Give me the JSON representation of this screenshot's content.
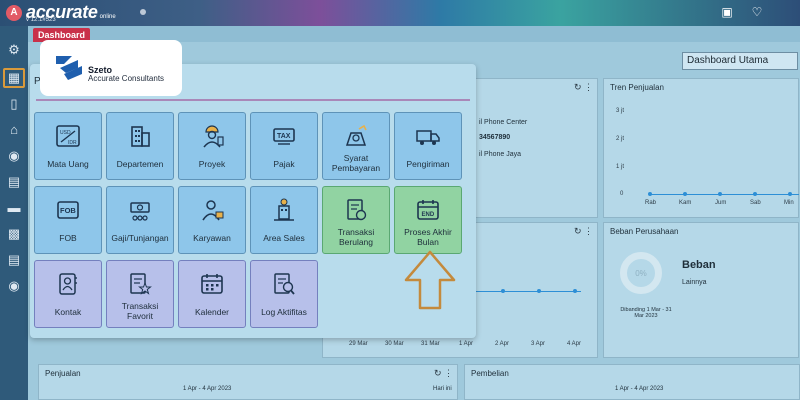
{
  "header": {
    "brand": "accurate",
    "brand_sub": "online",
    "version": "v 12.1#523",
    "icons": [
      "user-icon",
      "bell-icon"
    ]
  },
  "sidebar": {
    "icons": [
      "gear-icon",
      "building-icon",
      "phone-icon",
      "bank-icon",
      "bag-icon",
      "cart-icon",
      "truck-icon",
      "factory-icon",
      "receipt-icon",
      "report-icon"
    ],
    "active_index": 1
  },
  "tabs": [
    "Dashboard"
  ],
  "dashboard_select": "Dashboard Utama",
  "logo": {
    "line1": "Szeto",
    "line2": "Accurate Consultants"
  },
  "menu": {
    "header_letter": "P",
    "items": [
      {
        "label": "Mata Uang",
        "icon": "currency-icon",
        "color": "blue"
      },
      {
        "label": "Departemen",
        "icon": "building-icon",
        "color": "blue"
      },
      {
        "label": "Proyek",
        "icon": "engineer-icon",
        "color": "blue"
      },
      {
        "label": "Pajak",
        "icon": "tax-icon",
        "color": "blue"
      },
      {
        "label": "Syarat Pembayaran",
        "icon": "payment-terms-icon",
        "color": "blue"
      },
      {
        "label": "Pengiriman",
        "icon": "delivery-truck-icon",
        "color": "blue"
      },
      {
        "label": "FOB",
        "icon": "fob-icon",
        "color": "blue"
      },
      {
        "label": "Gaji/Tunjangan",
        "icon": "salary-icon",
        "color": "blue"
      },
      {
        "label": "Karyawan",
        "icon": "employee-icon",
        "color": "blue"
      },
      {
        "label": "Area Sales",
        "icon": "sales-area-icon",
        "color": "blue"
      },
      {
        "label": "Transaksi Berulang",
        "icon": "recurring-transaction-icon",
        "color": "green"
      },
      {
        "label": "Proses Akhir Bulan",
        "icon": "calendar-end-icon",
        "color": "green"
      },
      {
        "label": "Kontak",
        "icon": "contact-icon",
        "color": "purple"
      },
      {
        "label": "Transaksi Favorit",
        "icon": "favorite-transaction-icon",
        "color": "purple"
      },
      {
        "label": "Kalender",
        "icon": "calendar-icon",
        "color": "purple"
      },
      {
        "label": "Log Aktifitas",
        "icon": "activity-log-icon",
        "color": "purple"
      }
    ]
  },
  "company_panel": {
    "line1": "il Phone Center",
    "line2": "34567890",
    "line3": "il Phone Jaya"
  },
  "trend_panel": {
    "title": "Tren Penjualan",
    "yticks": [
      "3 jt",
      "2 jt",
      "1 jt",
      "0"
    ],
    "xticks": [
      "Rab",
      "Kam",
      "Jum",
      "Sab",
      "Min"
    ]
  },
  "mid_chart": {
    "xticks": [
      "29 Mar",
      "30 Mar",
      "31 Mar",
      "1 Apr",
      "2 Apr",
      "3 Apr",
      "4 Apr"
    ]
  },
  "expense_panel": {
    "title": "Beban Perusahaan",
    "donut_label": "0%",
    "heading": "Beban",
    "legend": "Lainnya",
    "compare": "Dibanding 1 Mar - 31 Mar 2023"
  },
  "sales_panel": {
    "title": "Penjualan",
    "range": "1 Apr - 4 Apr 2023",
    "right": "Hari ini"
  },
  "purchase_panel": {
    "title": "Pembelian",
    "range": "1 Apr - 4 Apr 2023"
  },
  "colors": {
    "tab": "#c9314a",
    "tile_blue": "#8ec6ea",
    "tile_green": "#91d3a2",
    "tile_purple": "#b7c0ea",
    "arrow": "#c48a3c"
  }
}
